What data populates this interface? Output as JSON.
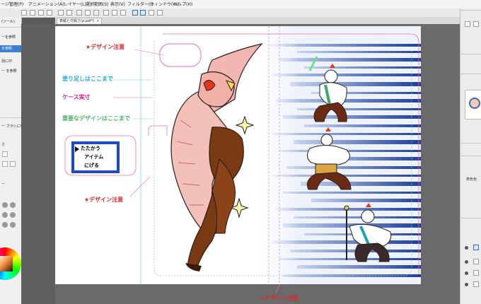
{
  "menubar": {
    "items": [
      "ージ管理(P)",
      "アニメーション(A)",
      "レイヤー(L)",
      "選択範囲(S)",
      "表示(V)",
      "フィルター(I)",
      "ウィンドウ(W)",
      "ヘルプ(H)"
    ]
  },
  "document_tab": {
    "title": "表紙と付録さ(p.pdf*)"
  },
  "left_panel": {
    "items": [
      "(ツール)",
      "ーを参照",
      "を参照",
      "別に印",
      "ー を参照",
      "ー ブラシに印"
    ],
    "fields": [
      "さ",
      "ー"
    ]
  },
  "right_panel": {
    "label_color": "表色色"
  },
  "annotations": {
    "design_caution_top": "★デザイン注意",
    "design_caution_left": "★デザイン注意",
    "design_caution_bottom": "★デザイン注意",
    "bleed_label": "塗り足しはここまで",
    "case_size_label": "ケース実寸",
    "safe_area_label": "重要なデザインはここまで"
  },
  "game_button": {
    "line1": "たたかう",
    "line2": "アイテム",
    "line3": "にげる"
  },
  "colors": {
    "accent": "#3d7fd1",
    "caution_red": "#e0282d",
    "bleed_cyan": "#22a8d6",
    "case_magenta": "#d4238f",
    "safe_green": "#4fb36b",
    "button_border": "#1f49c8",
    "stripe_blue": "#2b4fb0"
  }
}
